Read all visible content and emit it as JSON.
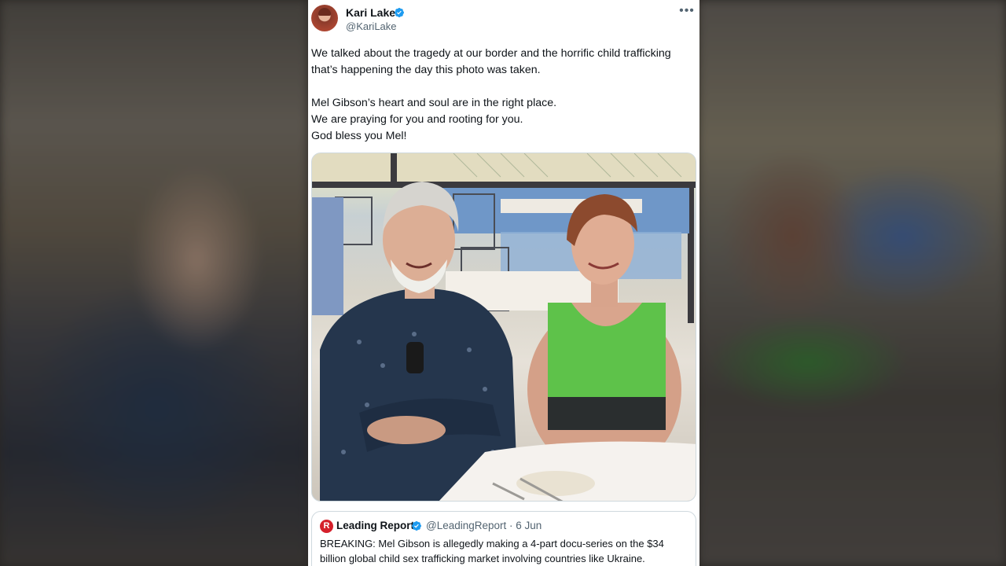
{
  "tweet": {
    "display_name": "Kari Lake",
    "handle": "@KariLake",
    "verified_icon": "verified-badge-icon",
    "more_icon": "more-options-icon",
    "paragraph_1": "We talked about the tragedy at our border and the horrific child trafficking that’s happening the day this photo was taken.",
    "line_2": "Mel Gibson’s heart and soul are in the right place.",
    "line_3": "We are praying for you and rooting for you.",
    "line_4": "God bless you Mel!"
  },
  "quoted_tweet": {
    "display_name": "Leading Report",
    "logo_letter": "R",
    "handle_date": "@LeadingReport · 6 Jun",
    "text": "BREAKING: Mel Gibson is allegedly making a 4-part docu-series on the $34 billion global child sex trafficking market involving countries like Ukraine."
  },
  "colors": {
    "verified": "#1d9bf0",
    "text_primary": "#0f1419",
    "text_secondary": "#536471",
    "brand_red": "#d5202b"
  }
}
